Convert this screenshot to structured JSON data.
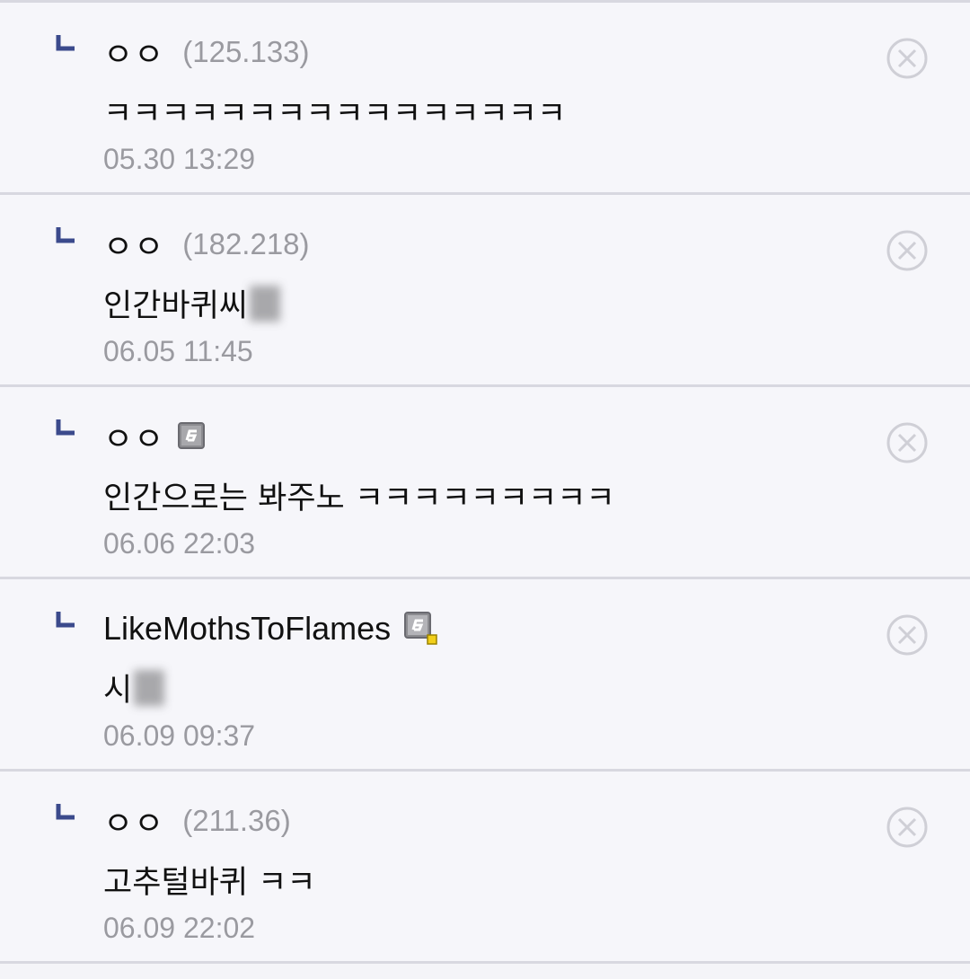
{
  "replies": [
    {
      "nick": "ㅇㅇ",
      "ip": "(125.133)",
      "text": "ㅋㅋㅋㅋㅋㅋㅋㅋㅋㅋㅋㅋㅋㅋㅋㅋ",
      "date": "05.30 13:29"
    },
    {
      "nick": "ㅇㅇ",
      "ip": "(182.218)",
      "text": "인간바퀴씨",
      "date": "06.05 11:45"
    },
    {
      "nick": "ㅇㅇ",
      "gallog_icon": "fixed-nick-icon",
      "text": "인간으로는 봐주노 ㅋㅋㅋㅋㅋㅋㅋㅋㅋ",
      "date": "06.06 22:03"
    },
    {
      "nick": "LikeMothsToFlames",
      "gallog_icon": "fixed-nick-icon-yellow-badge",
      "text": "시",
      "date": "06.09 09:37"
    },
    {
      "nick": "ㅇㅇ",
      "ip": "(211.36)",
      "text": "고추털바퀴 ㅋㅋ",
      "date": "06.09 22:02"
    }
  ],
  "colors": {
    "background": "#f6f6fa",
    "divider": "#d8d8e0",
    "reply_arrow": "#3b4a8c",
    "meta_text": "#9a9aa0",
    "delete_icon": "#cfcfd6"
  }
}
